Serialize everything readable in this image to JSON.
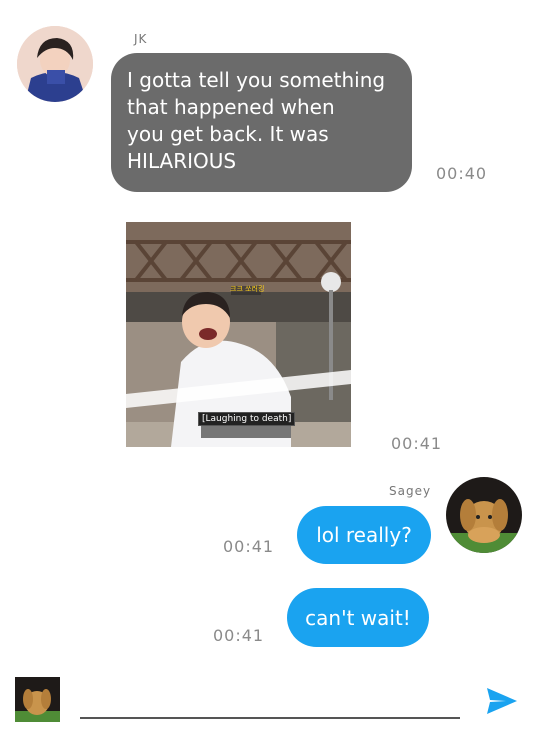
{
  "messages": [
    {
      "sender": "JK",
      "text_lines": [
        "I gotta tell you something",
        "that happened when",
        "you get back. It was",
        "HILARIOUS"
      ],
      "time": "00:40"
    },
    {
      "sender": "JK",
      "type": "image",
      "image_caption": "[Laughing to death]",
      "image_top_caption": "크크 쏘러킹",
      "time": "00:41"
    },
    {
      "sender": "Sagey",
      "text": "lol really?",
      "time": "00:41"
    },
    {
      "sender": "Sagey",
      "text": "can't wait!",
      "time": "00:41"
    }
  ],
  "colors": {
    "incoming_bubble": "#6b6b6b",
    "outgoing_bubble": "#1aa3f0",
    "send_button": "#1aa3f0"
  },
  "icons": {
    "send": "send-icon"
  }
}
